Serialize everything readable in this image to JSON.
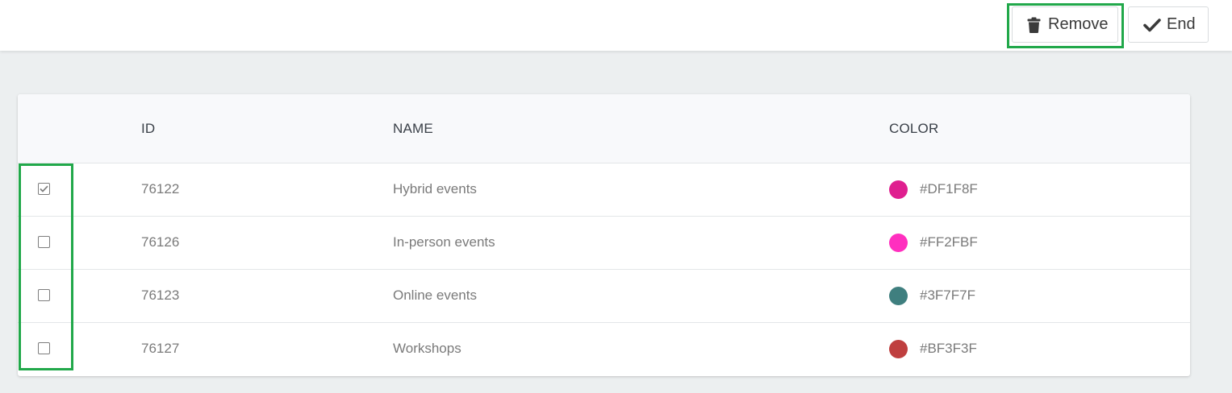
{
  "toolbar": {
    "remove_label": "Remove",
    "remove_icon": "trash-icon",
    "end_label": "End",
    "end_icon": "check-icon"
  },
  "table": {
    "columns": [
      "ID",
      "NAME",
      "COLOR"
    ],
    "rows": [
      {
        "checked": true,
        "id": "76122",
        "name": "Hybrid events",
        "color": "#DF1F8F"
      },
      {
        "checked": false,
        "id": "76126",
        "name": "In-person events",
        "color": "#FF2FBF"
      },
      {
        "checked": false,
        "id": "76123",
        "name": "Online events",
        "color": "#3F7F7F"
      },
      {
        "checked": false,
        "id": "76127",
        "name": "Workshops",
        "color": "#BF3F3F"
      }
    ]
  },
  "colors": {
    "highlight": "#21a84a",
    "checkbox_border": "#7d7d7d",
    "text_muted": "#7a7a7a",
    "text_header": "#3a4048"
  }
}
